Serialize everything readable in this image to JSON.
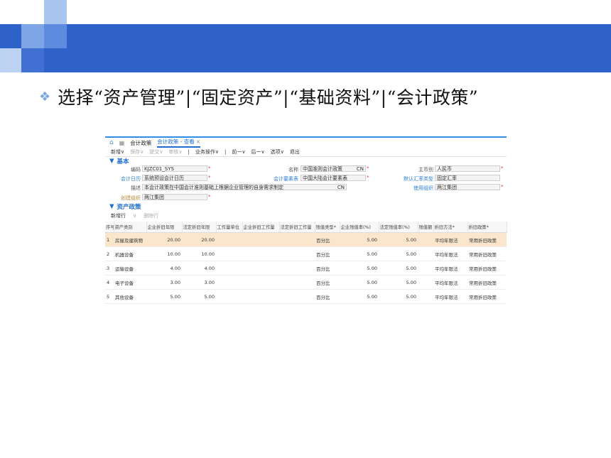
{
  "slide": {
    "heading": "选择“资产管理”|“固定资产”|“基础资料”|“会计政策”"
  },
  "app": {
    "nav_tab_1": "会计政策",
    "nav_tab_2": "会计政策 - 查看",
    "toolbar": [
      "新增∨",
      "保存∨",
      "提交∨",
      "审核∨",
      "|",
      "业务操作∨",
      "|",
      "前一∨",
      "后一∨",
      "选项∨",
      "退出"
    ],
    "section_basic": "基本",
    "section_policy": "资产政策",
    "form": {
      "code_label": "编码",
      "code_value": "KJZC01_SYS",
      "name_label": "名称",
      "name_value": "中国准则会计政策",
      "name_lang": "CN",
      "currency_label": "主币别",
      "currency_value": "人民币",
      "calendar_label": "会计日历",
      "calendar_value": "系统预设会计日历",
      "elements_label": "会计要素表",
      "elements_value": "中国大陆会计要素表",
      "rate_label": "默认汇率类型",
      "rate_value": "固定汇率",
      "desc_label": "描述",
      "desc_value": "本会计政策在中国会计准则基础上根据企业管理的自身需求制定",
      "desc_lang": "CN",
      "use_org_label": "使用组织",
      "use_org_value": "两江集团",
      "create_org_label": "创建组织",
      "create_org_value": "两江集团"
    },
    "grid_toolbar": {
      "add_row": "新增行",
      "delete_row": "删除行"
    },
    "columns": [
      "序号",
      "资产类别",
      "企业折旧年限",
      "法定折旧年限",
      "工作量单位",
      "企业折旧工作量",
      "法定折旧工作量",
      "残值类型*",
      "企业残值率(%)",
      "法定残值率(%)",
      "残值额",
      "折旧方法*",
      "折旧政策*"
    ],
    "rows": [
      [
        "1",
        "房屋及建筑物",
        "20.00",
        "20.00",
        "",
        "",
        "",
        "百分比",
        "5.00",
        "5.00",
        "",
        "平均年限法",
        "常用折旧政策"
      ],
      [
        "2",
        "机器设备",
        "10.00",
        "10.00",
        "",
        "",
        "",
        "百分比",
        "5.00",
        "5.00",
        "",
        "平均年限法",
        "常用折旧政策"
      ],
      [
        "3",
        "运输设备",
        "4.00",
        "4.00",
        "",
        "",
        "",
        "百分比",
        "5.00",
        "5.00",
        "",
        "平均年限法",
        "常用折旧政策"
      ],
      [
        "4",
        "电子设备",
        "3.00",
        "3.00",
        "",
        "",
        "",
        "百分比",
        "5.00",
        "5.00",
        "",
        "平均年限法",
        "常用折旧政策"
      ],
      [
        "5",
        "其他设备",
        "5.00",
        "5.00",
        "",
        "",
        "",
        "百分比",
        "5.00",
        "5.00",
        "",
        "平均年限法",
        "常用折旧政策"
      ]
    ]
  },
  "colors": {
    "banner": "#2f62c9",
    "accent": "#1e6fd1",
    "selected_row": "#fae6cc"
  }
}
